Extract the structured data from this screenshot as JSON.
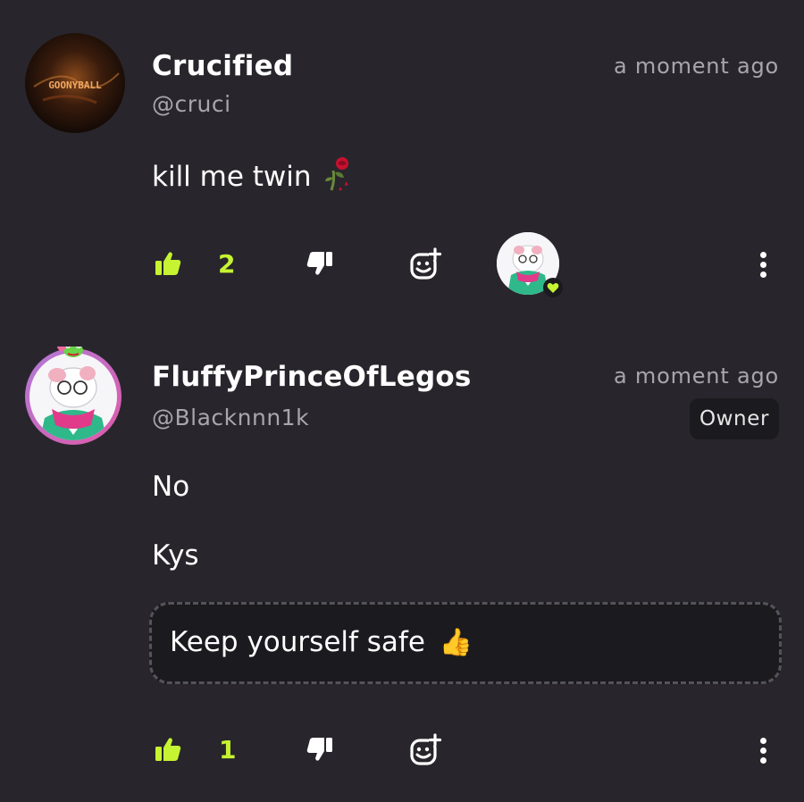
{
  "comments": [
    {
      "username": "Crucified",
      "handle": "@cruci",
      "timestamp": "a moment ago",
      "text": "kill me twin",
      "emoji": "wilted-rose",
      "avatar_text": "GOONYBALL",
      "likes": "2"
    },
    {
      "username": "FluffyPrinceOfLegos",
      "handle": "@Blacknnn1k",
      "timestamp": "a moment ago",
      "badge": "Owner",
      "lines": [
        "No",
        "Kys"
      ],
      "quote": "Keep yourself safe",
      "quote_emoji": "👍",
      "likes": "1"
    }
  ],
  "colors": {
    "background": "#28262c",
    "accent": "#c6f432",
    "muted": "#a8a6ac",
    "panel": "#1b1a1e"
  },
  "icons": [
    "thumbs-up-icon",
    "thumbs-down-icon",
    "add-reaction-icon",
    "more-options-icon",
    "heart-icon"
  ]
}
